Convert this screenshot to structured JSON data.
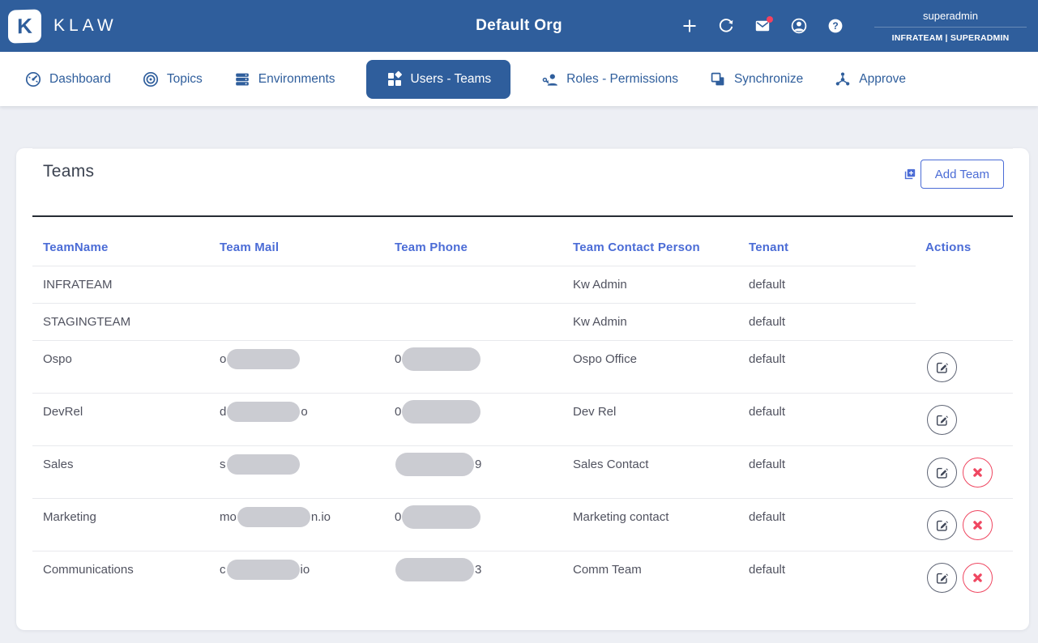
{
  "header": {
    "brand": "KLAW",
    "title": "Default Org",
    "user": {
      "name": "superadmin",
      "context": "INFRATEAM | SUPERADMIN"
    },
    "actions": [
      {
        "name": "add",
        "icon": "plus-icon",
        "badge": false
      },
      {
        "name": "refresh",
        "icon": "refresh-icon",
        "badge": false
      },
      {
        "name": "mail",
        "icon": "mail-icon",
        "badge": true
      },
      {
        "name": "account",
        "icon": "account-icon",
        "badge": false
      },
      {
        "name": "help",
        "icon": "help-icon",
        "badge": false
      }
    ]
  },
  "nav": [
    {
      "label": "Dashboard",
      "icon": "dashboard-icon",
      "active": false
    },
    {
      "label": "Topics",
      "icon": "topics-icon",
      "active": false
    },
    {
      "label": "Environments",
      "icon": "environments-icon",
      "active": false
    },
    {
      "label": "Users - Teams",
      "icon": "users-teams-icon",
      "active": true
    },
    {
      "label": "Roles - Permissions",
      "icon": "roles-icon",
      "active": false
    },
    {
      "label": "Synchronize",
      "icon": "synchronize-icon",
      "active": false
    },
    {
      "label": "Approve",
      "icon": "approve-icon",
      "active": false
    }
  ],
  "teams": {
    "title": "Teams",
    "add_button": "Add Team",
    "columns": [
      "TeamName",
      "Team Mail",
      "Team Phone",
      "Team Contact Person",
      "Tenant",
      "Actions"
    ],
    "header_divider": "short",
    "rows": [
      {
        "name": "INFRATEAM",
        "mail": null,
        "phone": null,
        "contact": "Kw Admin",
        "tenant": "default",
        "edit": false,
        "delete": false,
        "divider": "short"
      },
      {
        "name": "STAGINGTEAM",
        "mail": null,
        "phone": null,
        "contact": "Kw Admin",
        "tenant": "default",
        "edit": false,
        "delete": false,
        "divider": "full"
      },
      {
        "name": "Ospo",
        "mail": {
          "prefix": "o",
          "redacted": true,
          "suffix": ""
        },
        "phone": {
          "prefix": "0",
          "redacted": true,
          "suffix": ""
        },
        "contact": "Ospo Office",
        "tenant": "default",
        "edit": true,
        "delete": false,
        "divider": "full"
      },
      {
        "name": "DevRel",
        "mail": {
          "prefix": "d",
          "redacted": true,
          "suffix": "o"
        },
        "phone": {
          "prefix": "0",
          "redacted": true,
          "suffix": ""
        },
        "contact": "Dev Rel",
        "tenant": "default",
        "edit": true,
        "delete": false,
        "divider": "full"
      },
      {
        "name": "Sales",
        "mail": {
          "prefix": "s",
          "redacted": true,
          "suffix": ""
        },
        "phone": {
          "prefix": "",
          "redacted": true,
          "suffix": "9"
        },
        "contact": "Sales Contact",
        "tenant": "default",
        "edit": true,
        "delete": true,
        "divider": "full"
      },
      {
        "name": "Marketing",
        "mail": {
          "prefix": "mo",
          "redacted": true,
          "suffix": "n.io"
        },
        "phone": {
          "prefix": "0",
          "redacted": true,
          "suffix": ""
        },
        "contact": "Marketing contact",
        "tenant": "default",
        "edit": true,
        "delete": true,
        "divider": "full"
      },
      {
        "name": "Communications",
        "mail": {
          "prefix": "c",
          "redacted": true,
          "suffix": "io"
        },
        "phone": {
          "prefix": "",
          "redacted": true,
          "suffix": "3"
        },
        "contact": "Comm Team",
        "tenant": "default",
        "edit": true,
        "delete": true,
        "divider": "none"
      }
    ]
  },
  "colors": {
    "header_bg": "#2F5E9C",
    "accent_blue": "#4B6CD6",
    "delete_red": "#EF4761",
    "badge_red": "#F4415F"
  }
}
